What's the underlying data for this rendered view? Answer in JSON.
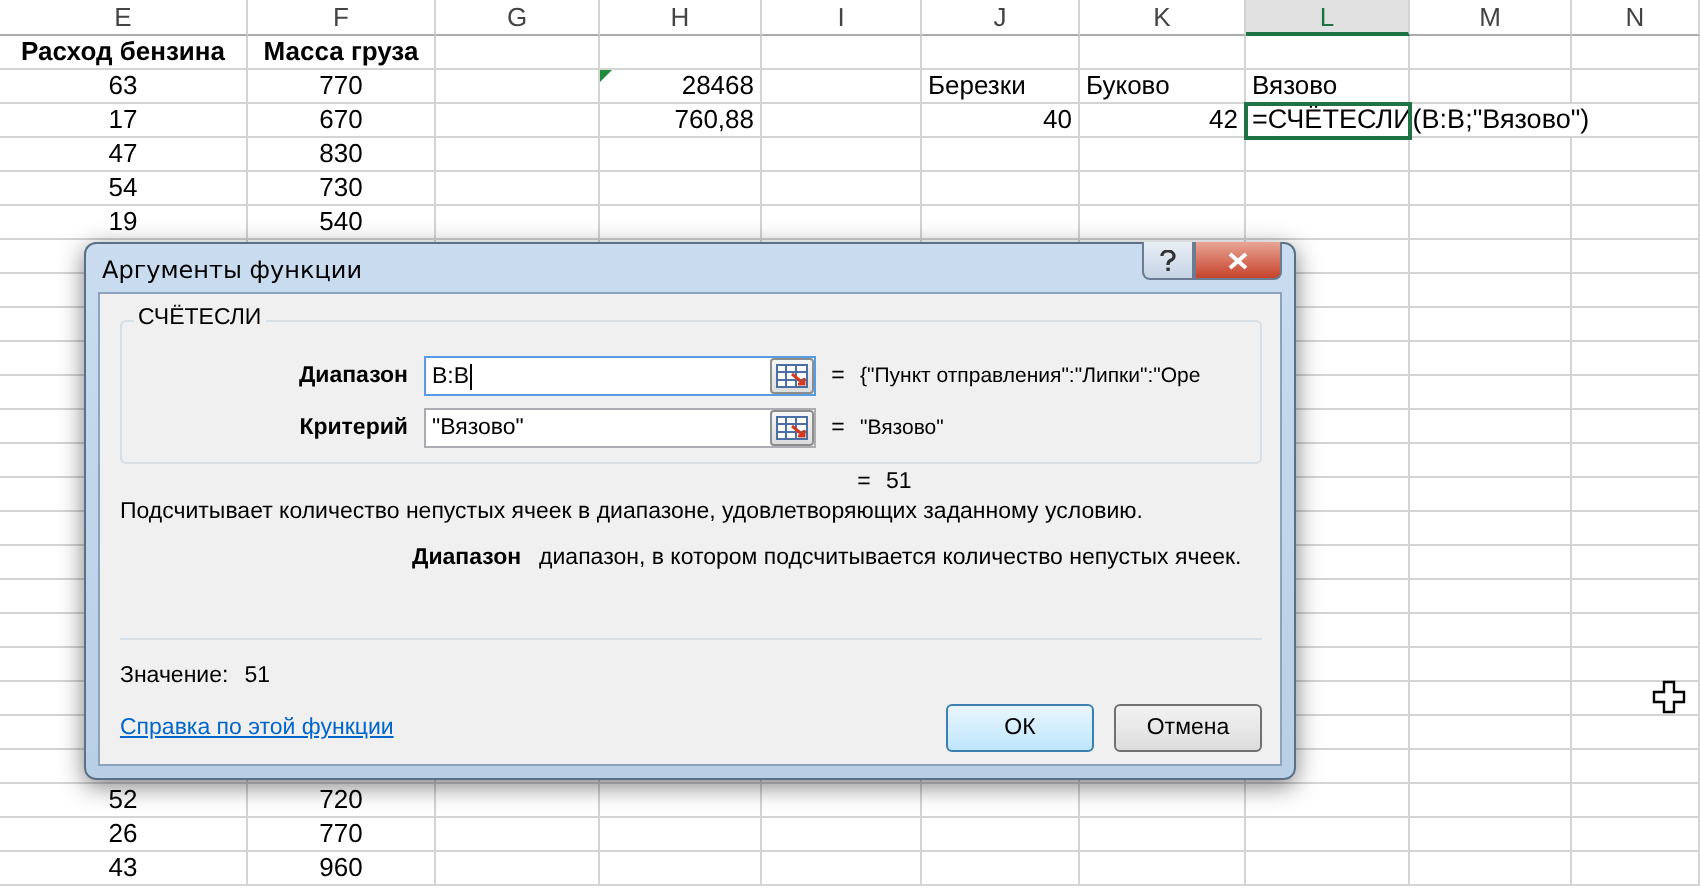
{
  "sheet": {
    "columns": [
      {
        "label": "E",
        "selected": false
      },
      {
        "label": "F",
        "selected": false
      },
      {
        "label": "G",
        "selected": false
      },
      {
        "label": "H",
        "selected": false
      },
      {
        "label": "I",
        "selected": false
      },
      {
        "label": "J",
        "selected": false
      },
      {
        "label": "K",
        "selected": false
      },
      {
        "label": "L",
        "selected": true
      },
      {
        "label": "M",
        "selected": false
      },
      {
        "label": "N",
        "selected": false
      }
    ],
    "rows_top": [
      {
        "cells": [
          {
            "text": "Расход бензина",
            "kind": "heading"
          },
          {
            "text": "Масса груза",
            "kind": "heading"
          },
          {
            "kind": "blank"
          },
          {
            "kind": "blank"
          },
          {
            "kind": "blank"
          },
          {
            "kind": "blank"
          },
          {
            "kind": "blank"
          },
          {
            "kind": "blank"
          },
          {
            "kind": "blank"
          },
          {
            "kind": "blank"
          }
        ]
      },
      {
        "cells": [
          {
            "text": "63",
            "kind": "centered"
          },
          {
            "text": "770",
            "kind": "centered"
          },
          {
            "kind": "blank"
          },
          {
            "text": "28468",
            "kind": "number",
            "error_flag": true
          },
          {
            "kind": "blank"
          },
          {
            "text": "Березки",
            "kind": "text"
          },
          {
            "text": "Буково",
            "kind": "text"
          },
          {
            "text": "Вязово",
            "kind": "text"
          },
          {
            "kind": "blank"
          },
          {
            "kind": "blank"
          }
        ]
      },
      {
        "cells": [
          {
            "text": "17",
            "kind": "centered"
          },
          {
            "text": "670",
            "kind": "centered"
          },
          {
            "kind": "blank"
          },
          {
            "text": "760,88",
            "kind": "number"
          },
          {
            "kind": "blank"
          },
          {
            "text": "40",
            "kind": "number"
          },
          {
            "text": "42",
            "kind": "number"
          },
          {
            "text": "=СЧЁТЕСЛИ(B:B;\"Вязово\")",
            "kind": "formula"
          }
        ]
      },
      {
        "cells": [
          {
            "text": "47",
            "kind": "centered"
          },
          {
            "text": "830",
            "kind": "centered"
          },
          {
            "kind": "blank"
          },
          {
            "kind": "blank"
          },
          {
            "kind": "blank"
          },
          {
            "kind": "blank"
          },
          {
            "kind": "blank"
          },
          {
            "kind": "blank"
          },
          {
            "kind": "blank"
          },
          {
            "kind": "blank"
          }
        ]
      },
      {
        "cells": [
          {
            "text": "54",
            "kind": "centered"
          },
          {
            "text": "730",
            "kind": "centered"
          },
          {
            "kind": "blank"
          },
          {
            "kind": "blank"
          },
          {
            "kind": "blank"
          },
          {
            "kind": "blank"
          },
          {
            "kind": "blank"
          },
          {
            "kind": "blank"
          },
          {
            "kind": "blank"
          },
          {
            "kind": "blank"
          }
        ]
      },
      {
        "cells": [
          {
            "text": "19",
            "kind": "centered"
          },
          {
            "text": "540",
            "kind": "centered"
          },
          {
            "kind": "blank"
          },
          {
            "kind": "blank"
          },
          {
            "kind": "blank"
          },
          {
            "kind": "blank"
          },
          {
            "kind": "blank"
          },
          {
            "kind": "blank"
          },
          {
            "kind": "blank"
          },
          {
            "kind": "blank"
          }
        ]
      }
    ],
    "rows_bottom": [
      {
        "cells": [
          {
            "text": "52",
            "kind": "centered"
          },
          {
            "text": "720",
            "kind": "centered"
          },
          {
            "kind": "blank"
          },
          {
            "kind": "blank"
          },
          {
            "kind": "blank"
          },
          {
            "kind": "blank"
          },
          {
            "kind": "blank"
          },
          {
            "kind": "blank"
          },
          {
            "kind": "blank"
          },
          {
            "kind": "blank"
          }
        ]
      },
      {
        "cells": [
          {
            "text": "26",
            "kind": "centered"
          },
          {
            "text": "770",
            "kind": "centered"
          },
          {
            "kind": "blank"
          },
          {
            "kind": "blank"
          },
          {
            "kind": "blank"
          },
          {
            "kind": "blank"
          },
          {
            "kind": "blank"
          },
          {
            "kind": "blank"
          },
          {
            "kind": "blank"
          },
          {
            "kind": "blank"
          }
        ]
      },
      {
        "cells": [
          {
            "text": "43",
            "kind": "centered"
          },
          {
            "text": "960",
            "kind": "centered"
          },
          {
            "kind": "blank"
          },
          {
            "kind": "blank"
          },
          {
            "kind": "blank"
          },
          {
            "kind": "blank"
          },
          {
            "kind": "blank"
          },
          {
            "kind": "blank"
          },
          {
            "kind": "blank"
          },
          {
            "kind": "blank"
          }
        ]
      }
    ]
  },
  "dialog": {
    "title": "Аргументы функции",
    "function_name": "СЧЁТЕСЛИ",
    "arguments": [
      {
        "label": "Диапазон",
        "value": "B:B",
        "focused": true,
        "equals": "=",
        "result": "{\"Пункт отправления\":\"Липки\":\"Оре"
      },
      {
        "label": "Критерий",
        "value": "\"Вязово\"",
        "focused": false,
        "equals": "=",
        "result": "\"Вязово\""
      }
    ],
    "result_equals": "=",
    "result": "51",
    "description": "Подсчитывает количество непустых ячеек в диапазоне, удовлетворяющих заданному условию.",
    "arg_help": {
      "name": "Диапазон",
      "text": "диапазон, в котором подсчитывается количество непустых ячеек."
    },
    "value_label": "Значение:",
    "value": "51",
    "help_link": "Справка по этой функции",
    "buttons": [
      {
        "label": "ОК",
        "default": true
      },
      {
        "label": "Отмена",
        "default": false
      }
    ]
  }
}
